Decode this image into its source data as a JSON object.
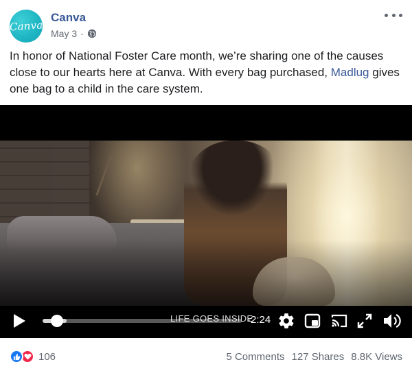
{
  "post": {
    "page_name": "Canva",
    "avatar_text": "Canva",
    "date": "May 3",
    "separator": "·",
    "text_before_link": "In honor of National Foster Care month, we’re sharing one of the causes close to our hearts here at Canva. With every bag purchased, ",
    "link_text": "Madlug",
    "text_after_link": " gives one bag to a child in the care system."
  },
  "video": {
    "caption_text": "LIFE GOES INSIDE",
    "time_remaining": "-2:24",
    "progress": 0.04,
    "buffered": 0.12
  },
  "footer": {
    "reaction_count": "106",
    "comments": "5 Comments",
    "shares": "127 Shares",
    "views": "8.8K Views"
  },
  "colors": {
    "link": "#385898",
    "avatar_bg": "#1fb7c4",
    "like": "#1877f2",
    "love": "#f0284a"
  }
}
